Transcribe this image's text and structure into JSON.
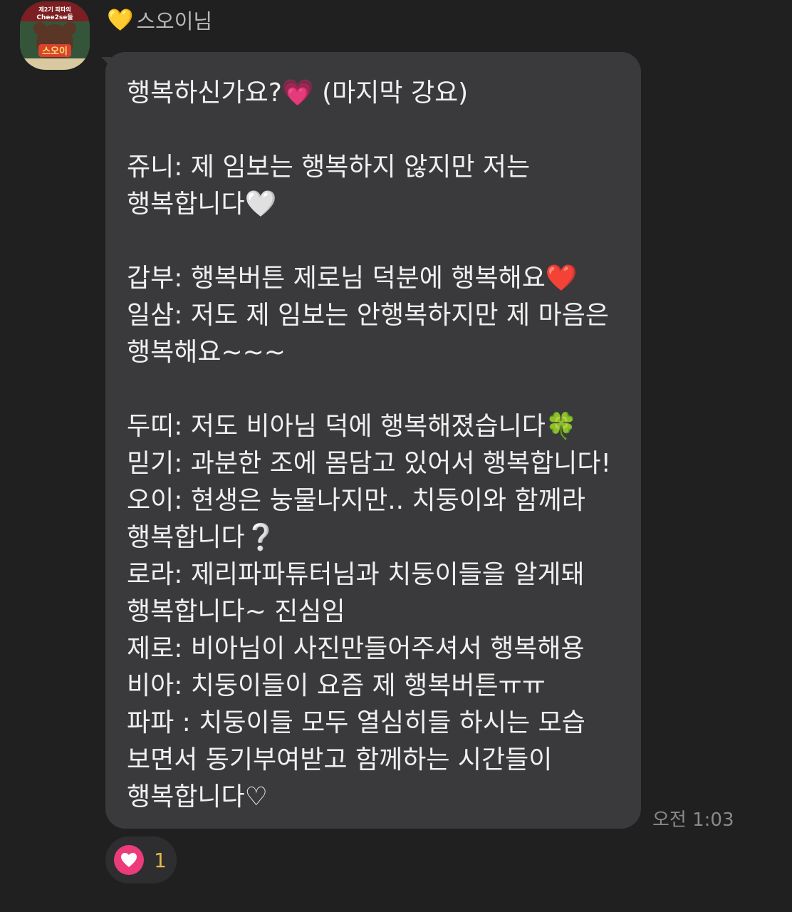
{
  "sender": {
    "badge_icon": "yellow-heart-icon",
    "badge_glyph": "💛",
    "badge_color": "#f6c42b",
    "name": "스오이님"
  },
  "avatar": {
    "line1": "제2기 파파의",
    "line2": "Chee2se들",
    "name_tag": "스오이"
  },
  "message": {
    "text": "행복하신가요?💗 (마지막 강요)\n\n쥬니: 제 임보는 행복하지 않지만 저는 행복합니다🤍\n\n갑부: 행복버튼 제로님 덕분에 행복해요❤️\n일삼: 저도 제 임보는 안행복하지만 제 마음은 행복해요~~~\n\n두띠: 저도 비아님 덕에 행복해졌습니다🍀\n믿기: 과분한 조에 몸담고 있어서 행복합니다!\n오이: 현생은 눙물나지만.. 치둥이와 함께라 행복합니다❔\n로라: 제리파파튜터님과 치둥이들을 알게돼 행복합니다~ 진심임\n제로: 비아님이 사진만들어주셔서 행복해용\n비아: 치둥이들이 요즘 제 행복버튼ㅠㅠ\n파파 : 치둥이들 모두 열심히들 하시는 모습 보면서 동기부여받고 함께하는 시간들이 행복합니다♡"
  },
  "timestamp": "오전 1:03",
  "reaction": {
    "icon": "heart-icon",
    "color": "#ec3b7a",
    "count": "1"
  }
}
